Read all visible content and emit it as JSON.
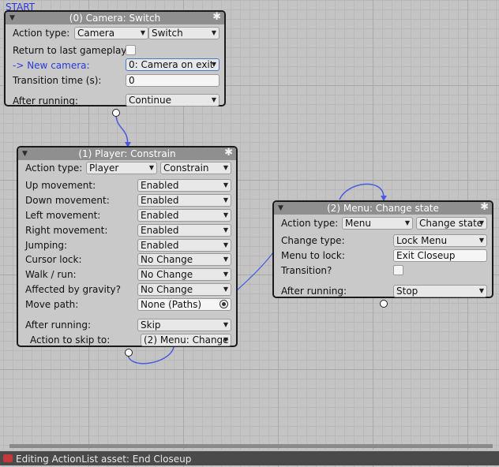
{
  "start_label": "START",
  "nodes": {
    "camera": {
      "title": "(0) Camera: Switch",
      "action_type_label": "Action type:",
      "action_category": "Camera",
      "action_name": "Switch",
      "return_label": "Return to last gameplay?",
      "new_camera_label": "-> New camera:",
      "new_camera_value": "0: Camera on exit",
      "transition_label": "Transition time (s):",
      "transition_value": "0",
      "after_running_label": "After running:",
      "after_running_value": "Continue"
    },
    "player": {
      "title": "(1) Player: Constrain",
      "action_type_label": "Action type:",
      "action_category": "Player",
      "action_name": "Constrain",
      "fields": [
        {
          "label": "Up movement:",
          "value": "Enabled"
        },
        {
          "label": "Down movement:",
          "value": "Enabled"
        },
        {
          "label": "Left movement:",
          "value": "Enabled"
        },
        {
          "label": "Right movement:",
          "value": "Enabled"
        },
        {
          "label": "Jumping:",
          "value": "Enabled"
        },
        {
          "label": "Cursor lock:",
          "value": "No Change"
        },
        {
          "label": "Walk / run:",
          "value": "No Change"
        },
        {
          "label": "Affected by gravity?",
          "value": "No Change"
        }
      ],
      "move_path_label": "Move path:",
      "move_path_value": "None (Paths)",
      "after_running_label": "After running:",
      "after_running_value": "Skip",
      "skip_to_label": "Action to skip to:",
      "skip_to_value": "(2) Menu: Change"
    },
    "menu": {
      "title": "(2) Menu: Change state",
      "action_type_label": "Action type:",
      "action_category": "Menu",
      "action_name": "Change state",
      "change_type_label": "Change type:",
      "change_type_value": "Lock Menu",
      "menu_to_lock_label": "Menu to lock:",
      "menu_to_lock_value": "Exit Closeup",
      "transition_label": "Transition?",
      "after_running_label": "After running:",
      "after_running_value": "Stop"
    }
  },
  "status_bar": {
    "text": "Editing ActionList asset: End Closeup"
  },
  "colors": {
    "wire": "#4a5ae0",
    "header": "#8f8f8f",
    "link_text": "#2a3ad8"
  },
  "icons": {
    "gear": "gear-icon",
    "collapse": "triangle-down-icon",
    "object_picker": "target-icon",
    "status": "actionlist-icon"
  }
}
